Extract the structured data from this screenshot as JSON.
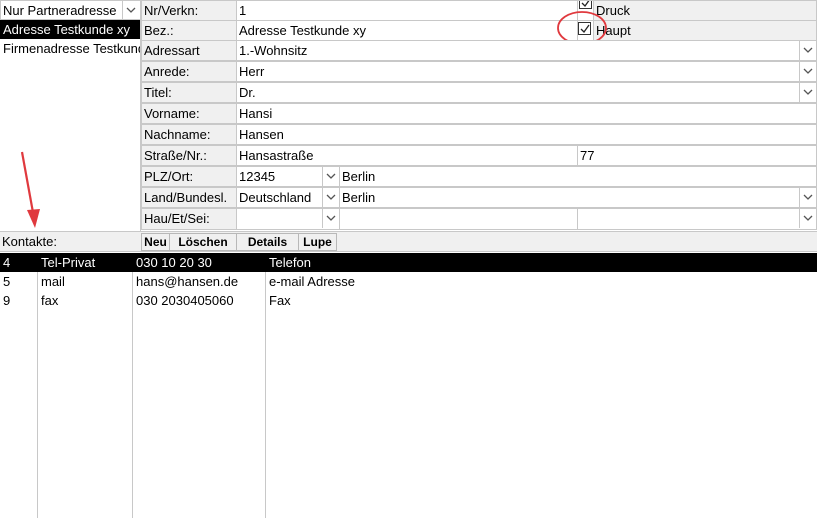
{
  "filter": {
    "value": "Nur Partneradresse"
  },
  "addresses": [
    {
      "label": "Adresse Testkunde xy",
      "selected": true
    },
    {
      "label": "Firmenadresse Testkunde",
      "selected": false
    }
  ],
  "form": {
    "nr_label": "Nr/Verkn:",
    "nr_value": "1",
    "druck_label": "Druck",
    "bez_label": "Bez.:",
    "bez_value": "Adresse Testkunde xy",
    "haupt_label": "Haupt",
    "adressart_label": "Adressart",
    "adressart_value": "1.-Wohnsitz",
    "anrede_label": "Anrede:",
    "anrede_value": "Herr",
    "titel_label": "Titel:",
    "titel_value": "Dr.",
    "vorname_label": "Vorname:",
    "vorname_value": "Hansi",
    "nachname_label": "Nachname:",
    "nachname_value": "Hansen",
    "strasse_label": "Straße/Nr.:",
    "strasse_value": "Hansastraße",
    "hausnr_value": "77",
    "plz_label": "PLZ/Ort:",
    "plz_value": "12345",
    "ort_value": "Berlin",
    "land_label": "Land/Bundesl.",
    "land_value": "Deutschland",
    "bundesland_value": "Berlin",
    "hau_label": "Hau/Et/Sei:"
  },
  "contacts_bar": {
    "label": "Kontakte:",
    "buttons": [
      "Neu",
      "Löschen",
      "Details",
      "Lupe"
    ]
  },
  "contacts": [
    {
      "nr": "4",
      "art": "Tel-Privat",
      "wert": "030 10 20 30",
      "typ": "Telefon",
      "selected": true
    },
    {
      "nr": "5",
      "art": "mail",
      "wert": "hans@hansen.de",
      "typ": "e-mail Adresse",
      "selected": false
    },
    {
      "nr": "9",
      "art": "fax",
      "wert": "030 2030405060",
      "typ": "Fax",
      "selected": false
    }
  ],
  "colors": {
    "selection": "#000000",
    "annotation": "#e0393e",
    "label_bg": "#f0f0f0",
    "border": "#c8c8c8"
  }
}
